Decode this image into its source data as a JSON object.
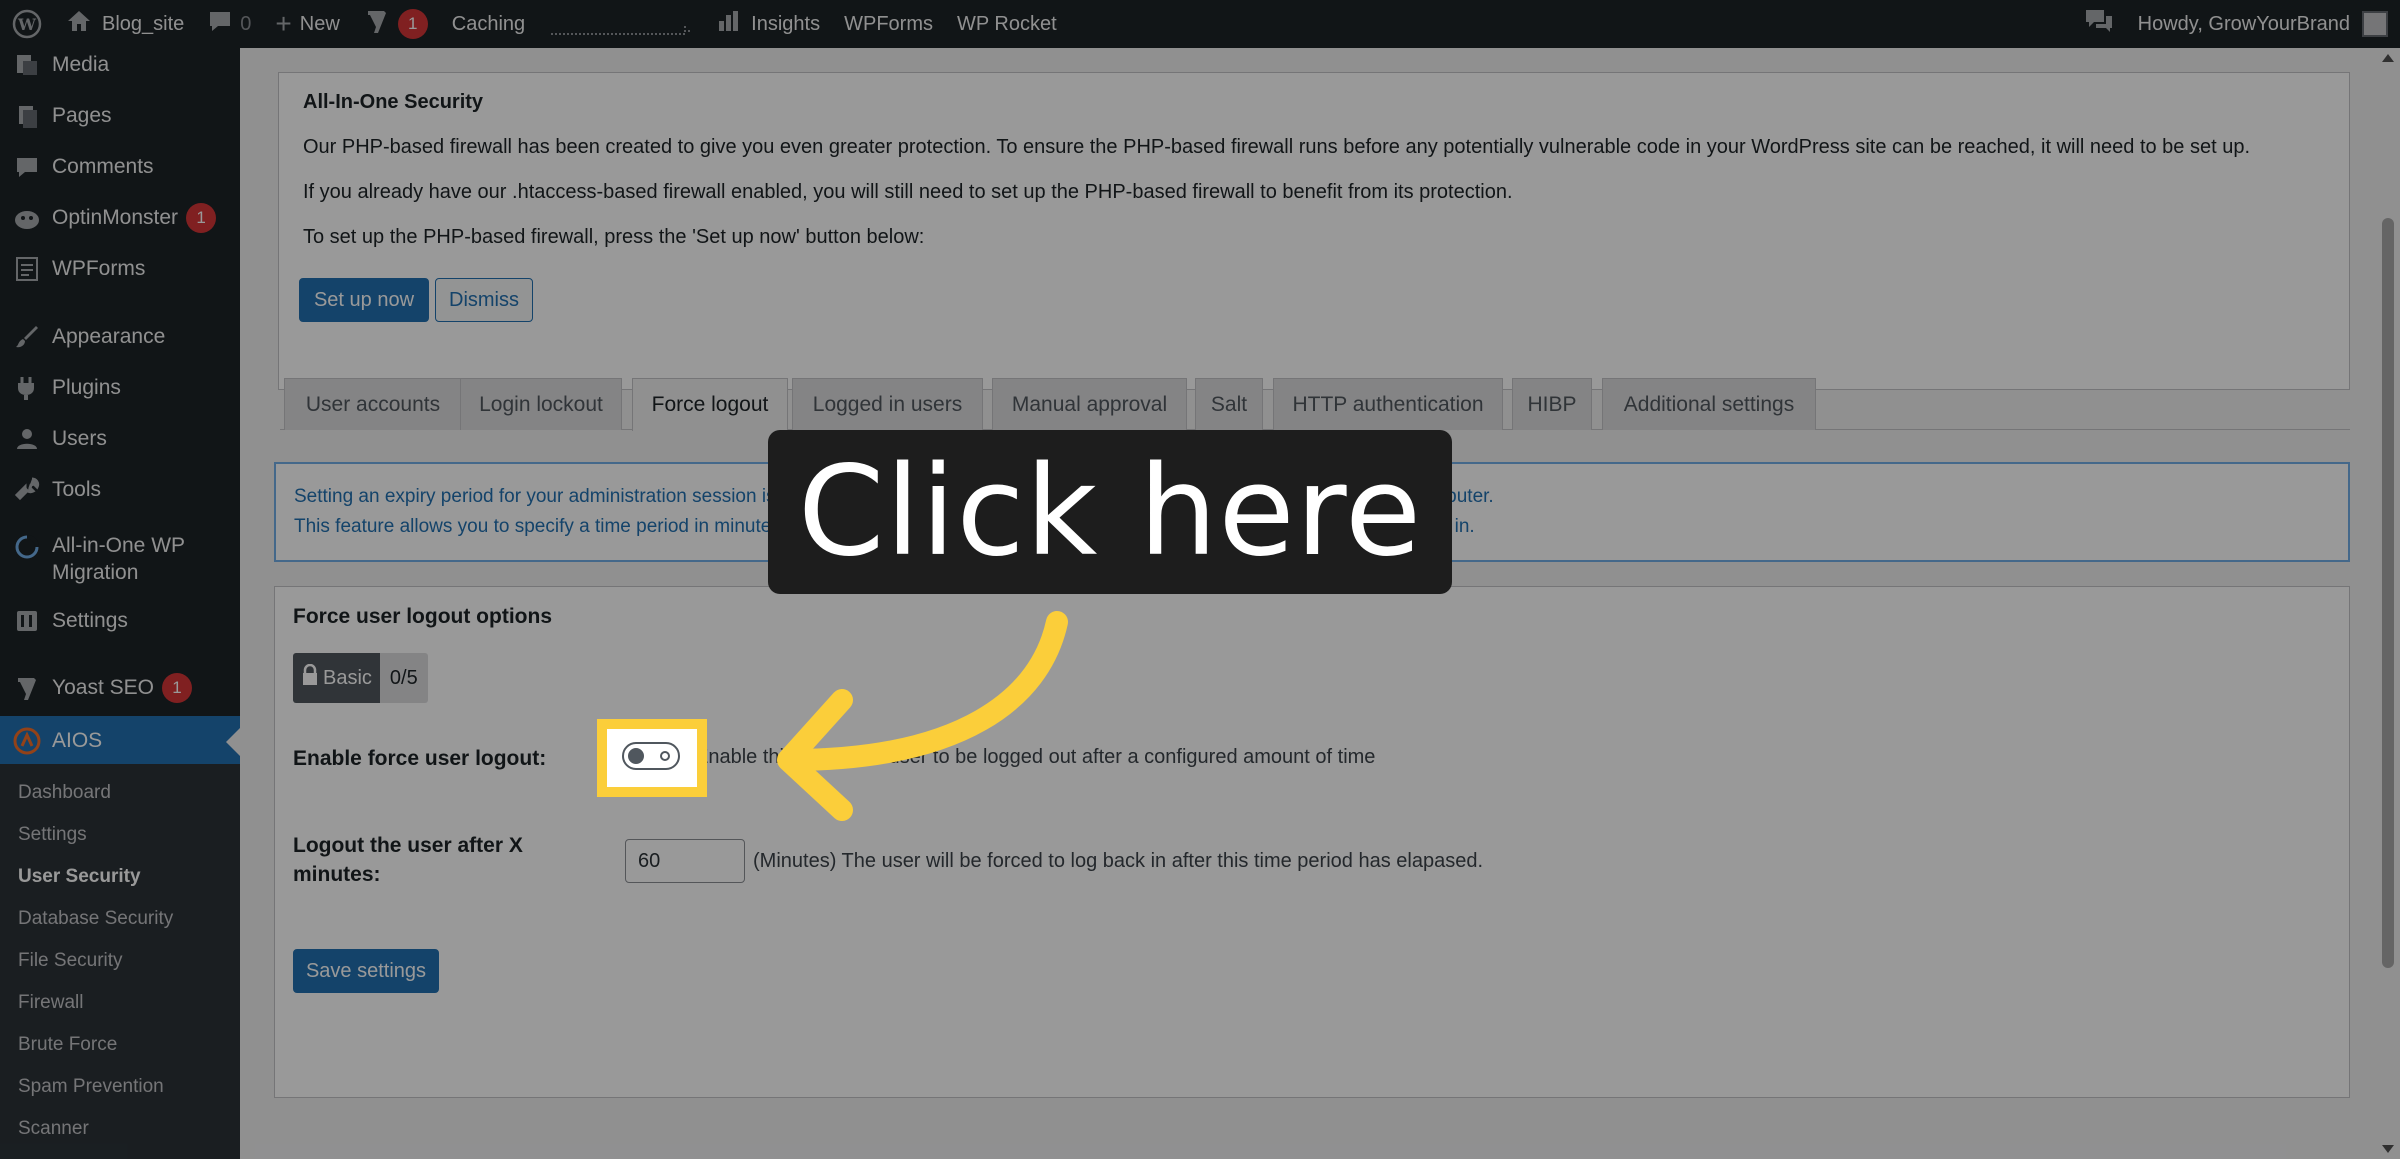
{
  "adminbar": {
    "site_name": "Blog_site",
    "comments_count": "0",
    "new_label": "New",
    "yoast_count": "1",
    "caching_label": "Caching",
    "insights_label": "Insights",
    "wpforms_label": "WPForms",
    "wprocket_label": "WP Rocket",
    "howdy": "Howdy, GrowYourBrand"
  },
  "sidebar": {
    "items": [
      {
        "label": "Media",
        "icon": "media-icon"
      },
      {
        "label": "Pages",
        "icon": "pages-icon"
      },
      {
        "label": "Comments",
        "icon": "comments-icon"
      },
      {
        "label": "OptinMonster",
        "icon": "optinmonster-icon",
        "badge": "1"
      },
      {
        "label": "WPForms",
        "icon": "wpforms-icon"
      },
      {
        "label": "Appearance",
        "icon": "appearance-icon"
      },
      {
        "label": "Plugins",
        "icon": "plugins-icon"
      },
      {
        "label": "Users",
        "icon": "users-icon"
      },
      {
        "label": "Tools",
        "icon": "tools-icon"
      },
      {
        "label": "All-in-One WP",
        "label2": "Migration",
        "icon": "migration-icon"
      },
      {
        "label": "Settings",
        "icon": "settings-icon"
      },
      {
        "label": "Yoast SEO",
        "icon": "yoast-icon",
        "badge": "1"
      },
      {
        "label": "AIOS",
        "icon": "aios-icon"
      }
    ],
    "submenu": [
      "Dashboard",
      "Settings",
      "User Security",
      "Database Security",
      "File Security",
      "Firewall",
      "Brute Force",
      "Spam Prevention",
      "Scanner"
    ]
  },
  "notice": {
    "title": "All-In-One Security",
    "line1": "Our PHP-based firewall has been created to give you even greater protection. To ensure the PHP-based firewall runs before any potentially vulnerable code in your WordPress site can be reached, it will need to be set up.",
    "line2": "If you already have our .htaccess-based firewall enabled, you will still need to set up the PHP-based firewall to benefit from its protection.",
    "line3": "To set up the PHP-based firewall, press the 'Set up now' button below:",
    "setup_label": "Set up now",
    "dismiss_label": "Dismiss"
  },
  "tabs": [
    "User accounts",
    "Login lockout",
    "Force logout",
    "Logged in users",
    "Manual approval",
    "Salt",
    "HTTP authentication",
    "HIBP",
    "Additional settings"
  ],
  "info": {
    "line1": "Setting an expiry period for your administration session is a simple way to protect against unauthorized access to your site from your computer.",
    "line2": "This feature allows you to specify a time period in minutes after which the admin session will expire and the user will be forced to log back in."
  },
  "options": {
    "title": "Force user logout options",
    "badge_left": "Basic",
    "badge_right": "0/5",
    "enable_label": "Enable force user logout:",
    "enable_desc": "Enable this to force a user to be logged out after a configured amount of time",
    "minutes_label": "Logout the user after X minutes:",
    "minutes_value": "60",
    "minutes_desc": "(Minutes) The user will be forced to log back in after this time period has elapased.",
    "save_label": "Save settings"
  },
  "callout": {
    "text": "Click here",
    "highlight_color": "#fbce3a"
  }
}
